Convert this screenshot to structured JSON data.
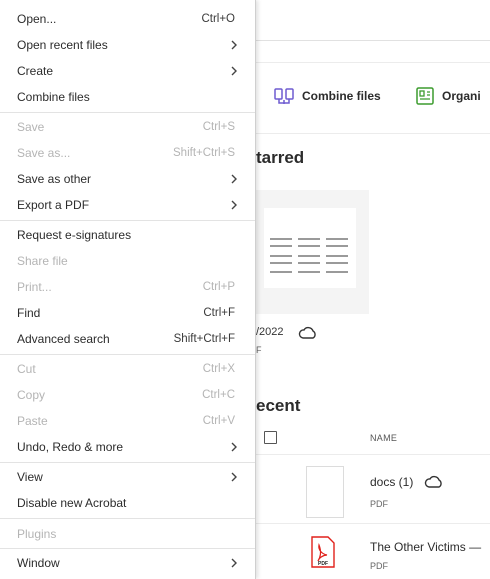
{
  "menu": {
    "items": [
      {
        "label": "Open...",
        "shortcut": "Ctrl+O",
        "submenu": false,
        "disabled": false
      },
      {
        "label": "Open recent files",
        "shortcut": "",
        "submenu": true,
        "disabled": false
      },
      {
        "label": "Create",
        "shortcut": "",
        "submenu": true,
        "disabled": false
      },
      {
        "label": "Combine files",
        "shortcut": "",
        "submenu": false,
        "disabled": false
      },
      {
        "label": "Save",
        "shortcut": "Ctrl+S",
        "submenu": false,
        "disabled": true
      },
      {
        "label": "Save as...",
        "shortcut": "Shift+Ctrl+S",
        "submenu": false,
        "disabled": true
      },
      {
        "label": "Save as other",
        "shortcut": "",
        "submenu": true,
        "disabled": false
      },
      {
        "label": "Export a PDF",
        "shortcut": "",
        "submenu": true,
        "disabled": false
      },
      {
        "label": "Request e-signatures",
        "shortcut": "",
        "submenu": false,
        "disabled": false
      },
      {
        "label": "Share file",
        "shortcut": "",
        "submenu": false,
        "disabled": true
      },
      {
        "label": "Print...",
        "shortcut": "Ctrl+P",
        "submenu": false,
        "disabled": true
      },
      {
        "label": "Find",
        "shortcut": "Ctrl+F",
        "submenu": false,
        "disabled": false
      },
      {
        "label": "Advanced search",
        "shortcut": "Shift+Ctrl+F",
        "submenu": false,
        "disabled": false
      },
      {
        "label": "Cut",
        "shortcut": "Ctrl+X",
        "submenu": false,
        "disabled": true
      },
      {
        "label": "Copy",
        "shortcut": "Ctrl+C",
        "submenu": false,
        "disabled": true
      },
      {
        "label": "Paste",
        "shortcut": "Ctrl+V",
        "submenu": false,
        "disabled": true
      },
      {
        "label": "Undo, Redo & more",
        "shortcut": "",
        "submenu": true,
        "disabled": false
      },
      {
        "label": "View",
        "shortcut": "",
        "submenu": true,
        "disabled": false
      },
      {
        "label": "Disable new Acrobat",
        "shortcut": "",
        "submenu": false,
        "disabled": false
      },
      {
        "label": "Plugins",
        "shortcut": "",
        "submenu": false,
        "disabled": true
      },
      {
        "label": "Window",
        "shortcut": "",
        "submenu": true,
        "disabled": false
      }
    ]
  },
  "toolbar": {
    "combine_label": "Combine files",
    "organize_label": "Organi"
  },
  "starred": {
    "title": "tarred",
    "date": "/2022",
    "subtext": "F"
  },
  "recent": {
    "title": "ecent",
    "column_name": "NAME",
    "files": [
      {
        "name": "docs (1)",
        "type": "PDF"
      },
      {
        "name": "The Other Victims —",
        "type": "PDF"
      }
    ]
  },
  "colors": {
    "pdf_red": "#e0211b",
    "combine_purple": "#6e5bd0",
    "organize_green": "#3c9c2e"
  },
  "icons": {
    "combine": "combine-files-icon",
    "organize": "organize-pages-icon",
    "cloud": "cloud-icon",
    "submenu": "chevron-right-icon",
    "pdf": "pdf-file-icon"
  }
}
